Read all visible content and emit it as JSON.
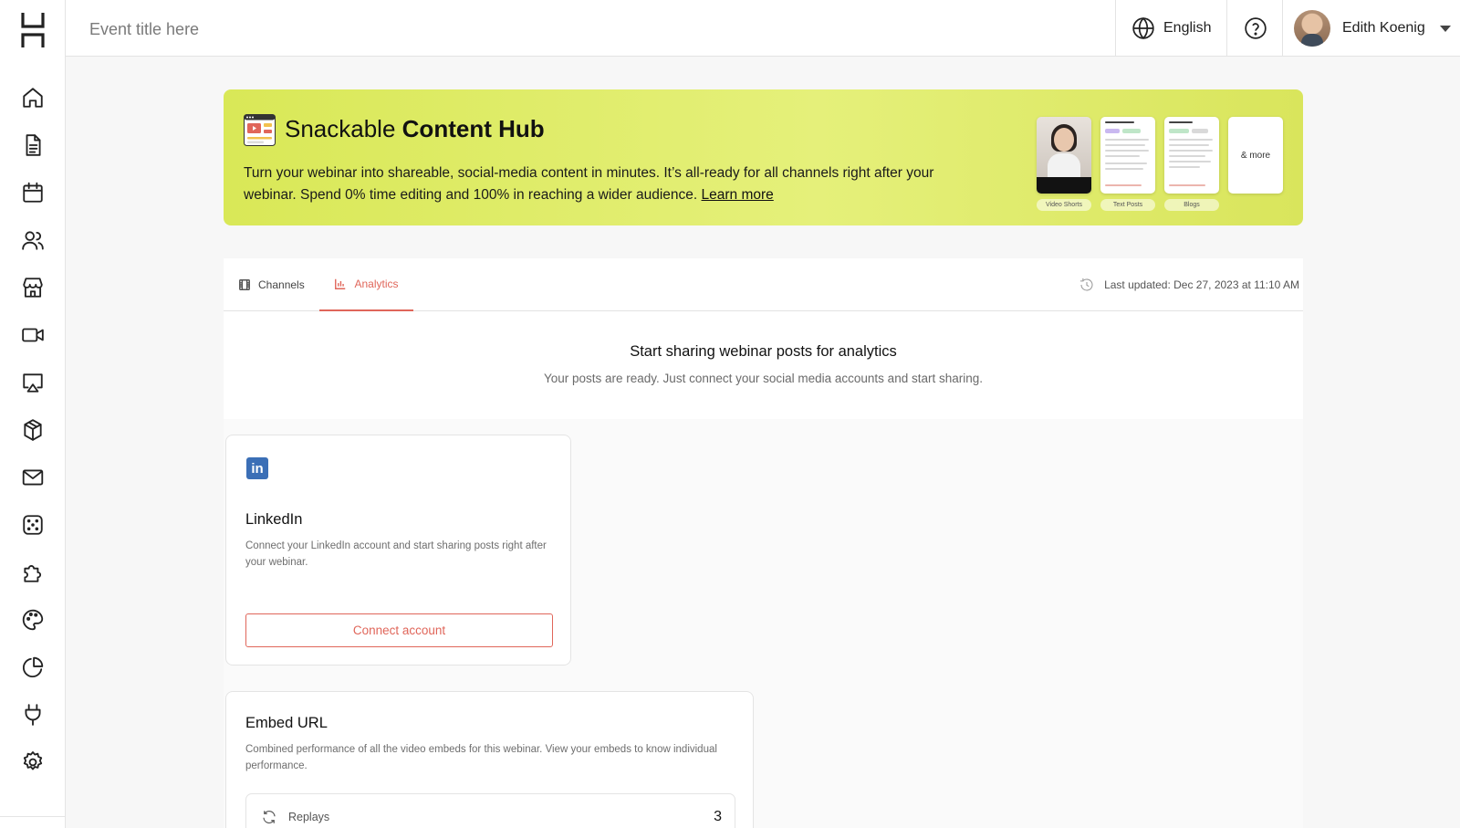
{
  "header": {
    "event_title_placeholder": "Event title here",
    "language": "English",
    "user_name": "Edith Koenig"
  },
  "sidebar": {
    "items": [
      {
        "icon": "home-icon"
      },
      {
        "icon": "document-icon"
      },
      {
        "icon": "calendar-icon"
      },
      {
        "icon": "users-icon"
      },
      {
        "icon": "store-icon"
      },
      {
        "icon": "video-camera-icon"
      },
      {
        "icon": "presentation-icon"
      },
      {
        "icon": "box-icon"
      },
      {
        "icon": "mail-icon"
      },
      {
        "icon": "dice-icon"
      },
      {
        "icon": "puzzle-icon"
      },
      {
        "icon": "palette-icon"
      },
      {
        "icon": "pie-chart-icon"
      },
      {
        "icon": "plug-icon"
      },
      {
        "icon": "settings-gear-icon"
      }
    ]
  },
  "banner": {
    "title_regular": "Snackable",
    "title_bold": "Content Hub",
    "description": "Turn your webinar into shareable, social-media content in minutes. It’s all-ready for all channels right after your webinar. Spend 0% time editing and 100% in reaching a wider audience.",
    "learn_more": "Learn more",
    "thumbnails": [
      "Video Shorts",
      "Text Posts",
      "Blogs",
      "& more"
    ],
    "accent_colors": [
      "#d9e857",
      "#e5f07a"
    ]
  },
  "tabs": {
    "channels": "Channels",
    "analytics": "Analytics",
    "active": "Analytics",
    "last_updated": "Last updated: Dec 27, 2023 at 11:10 AM"
  },
  "empty_state": {
    "title": "Start sharing webinar posts for analytics",
    "subtitle": "Your posts are ready. Just connect your social media accounts and start sharing."
  },
  "linkedin_card": {
    "icon_text": "in",
    "title": "LinkedIn",
    "description": "Connect your LinkedIn account and start sharing posts right after your webinar.",
    "button": "Connect account"
  },
  "embed_card": {
    "title": "Embed URL",
    "description": "Combined performance of all the video embeds for this webinar. View your embeds to know individual performance.",
    "rows": [
      {
        "label": "Replays",
        "value": "3"
      }
    ]
  },
  "colors": {
    "accent": "#e0665a",
    "linkedin": "#3b6fb6"
  }
}
